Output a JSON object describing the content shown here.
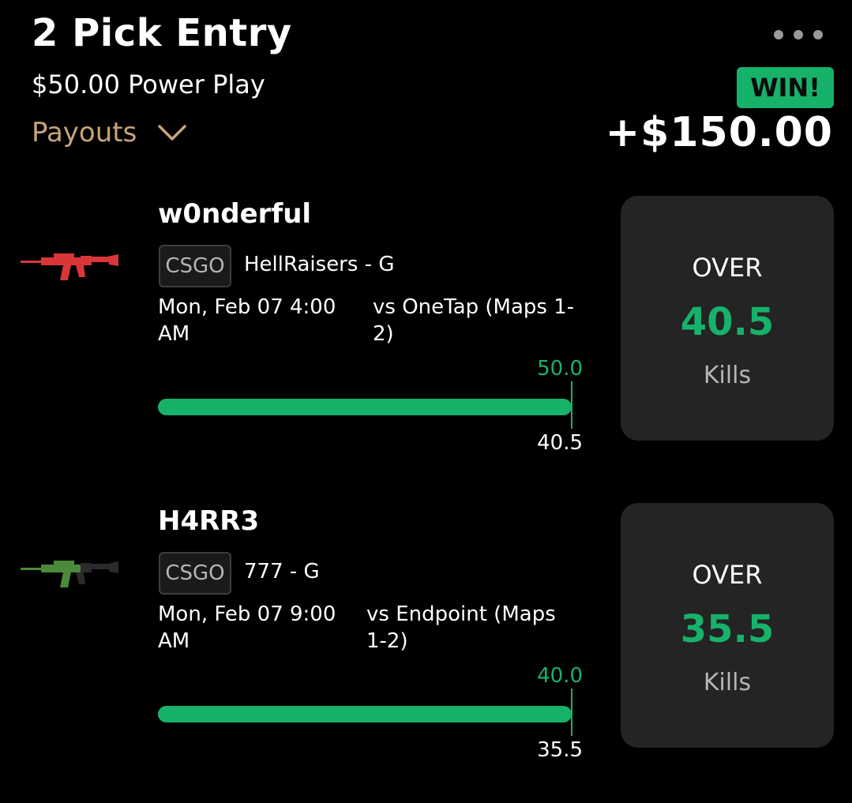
{
  "entry": {
    "title": "2 Pick Entry",
    "subtitle": "$50.00 Power Play",
    "payouts_label": "Payouts",
    "result_badge": "WIN!",
    "payout_amount": "+$150.00"
  },
  "colors": {
    "accent_green": "#17b26a",
    "payouts_gold": "#c9a37a",
    "card_bg": "#242424"
  },
  "picks": [
    {
      "player": "w0nderful",
      "game": "CSGO",
      "team": "HellRaisers - G",
      "date": "Mon, Feb 07 4:00 AM",
      "opponent": "vs OneTap (Maps 1-2)",
      "actual": "50.0",
      "line": "40.5",
      "direction": "OVER",
      "stat": "Kills",
      "weapon_icon": "red-rifle-icon"
    },
    {
      "player": "H4RR3",
      "game": "CSGO",
      "team": "777 - G",
      "date": "Mon, Feb 07 9:00 AM",
      "opponent": "vs Endpoint (Maps 1-2)",
      "actual": "40.0",
      "line": "35.5",
      "direction": "OVER",
      "stat": "Kills",
      "weapon_icon": "green-rifle-icon"
    }
  ]
}
